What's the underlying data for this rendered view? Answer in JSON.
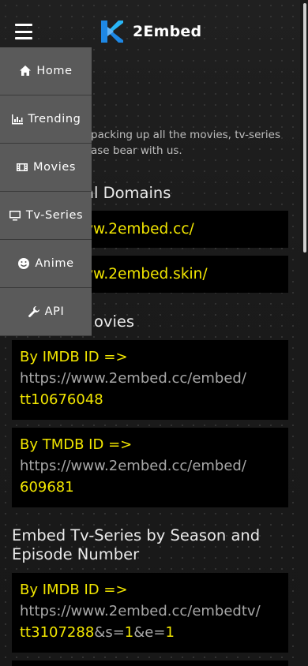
{
  "header": {
    "brand": "2Embed",
    "menu_icon": "hamburger-icon",
    "logo_icon": "k-logo-icon",
    "logo_colors": [
      "#1e88e5",
      "#29b6f6"
    ]
  },
  "notice": {
    "line1": "packing up all the movies, tv-series",
    "line2": "ase bear with us."
  },
  "domains": {
    "title": "al Domains",
    "items": [
      "vw.2embed.cc/",
      "vw.2embed.skin/"
    ]
  },
  "movies": {
    "title": "ovies",
    "imdb": {
      "label": "By IMDB ID =>",
      "url": "https://www.2embed.cc/embed/",
      "id": "tt10676048"
    },
    "tmdb": {
      "label": "By TMDB ID =>",
      "url": "https://www.2embed.cc/embed/",
      "id": "609681"
    }
  },
  "tv": {
    "title": "Embed Tv-Series by Season and Episode Number",
    "imdb": {
      "label": "By IMDB ID =>",
      "url": "https://www.2embed.cc/embedtv/",
      "id": "tt3107288",
      "s_param": "&s=",
      "s_val": "1",
      "e_param": "&e=",
      "e_val": "1"
    }
  },
  "menu": {
    "items": [
      {
        "label": "Home",
        "icon": "home-icon"
      },
      {
        "label": "Trending",
        "icon": "bar-chart-icon"
      },
      {
        "label": "Movies",
        "icon": "film-icon"
      },
      {
        "label": "Tv-Series",
        "icon": "tv-icon"
      },
      {
        "label": "Anime",
        "icon": "smile-icon"
      },
      {
        "label": "API",
        "icon": "wrench-icon"
      }
    ]
  },
  "colors": {
    "accent": "#f2e600",
    "menu_bg": "#5a5a5a",
    "page_bg": "#1b1b1b",
    "code_bg": "#000000"
  }
}
